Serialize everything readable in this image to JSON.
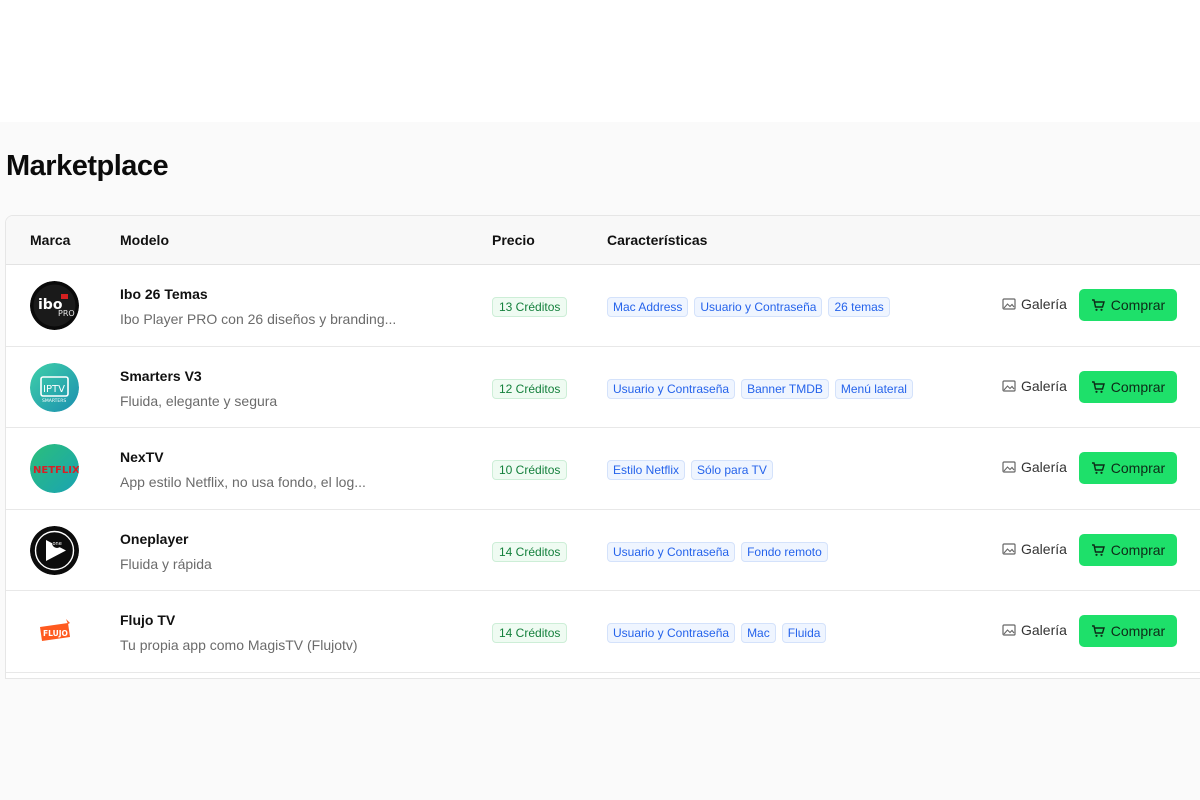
{
  "page": {
    "title": "Marketplace"
  },
  "table": {
    "headers": {
      "marca": "Marca",
      "modelo": "Modelo",
      "precio": "Precio",
      "caracteristicas": "Características"
    },
    "gallery_label": "Galería",
    "buy_label": "Comprar",
    "rows": [
      {
        "name": "Ibo 26 Temas",
        "desc": "Ibo Player PRO con 26 diseños y branding...",
        "price": "13 Créditos",
        "tags": [
          "Mac Address",
          "Usuario y Contraseña",
          "26 temas"
        ],
        "logo": "ibo-pro-logo",
        "logo_text": "ibo PRO"
      },
      {
        "name": "Smarters V3",
        "desc": "Fluida, elegante y segura",
        "price": "12 Créditos",
        "tags": [
          "Usuario y Contraseña",
          "Banner TMDB",
          "Menú lateral"
        ],
        "logo": "iptv-smarters-logo",
        "logo_text": "IPTV SMARTERS"
      },
      {
        "name": "NexTV",
        "desc": "App estilo Netflix, no usa fondo, el log...",
        "price": "10 Créditos",
        "tags": [
          "Estilo Netflix",
          "Sólo para TV"
        ],
        "logo": "netflix-logo",
        "logo_text": "NETFLIX"
      },
      {
        "name": "Oneplayer",
        "desc": "Fluida y rápida",
        "price": "14 Créditos",
        "tags": [
          "Usuario y Contraseña",
          "Fondo remoto"
        ],
        "logo": "oneplayer-logo",
        "logo_text": "one"
      },
      {
        "name": "Flujo TV",
        "desc": "Tu propia app como MagisTV (Flujotv)",
        "price": "14 Créditos",
        "tags": [
          "Usuario y Contraseña",
          "Mac",
          "Fluida"
        ],
        "logo": "flujo-logo",
        "logo_text": "FLUJO"
      }
    ]
  },
  "colors": {
    "buy_button": "#1ee06a",
    "price_text": "#14803c",
    "tag_text": "#2563eb"
  }
}
